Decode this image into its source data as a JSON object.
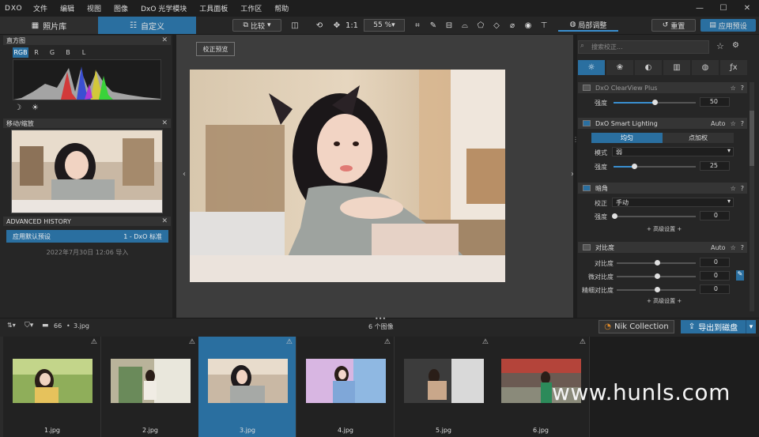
{
  "app": {
    "logo": "DXO",
    "menu": [
      "文件",
      "编辑",
      "视图",
      "图像",
      "DxO 光学模块",
      "工具面板",
      "工作区",
      "帮助"
    ]
  },
  "window": {
    "min": "—",
    "max": "☐",
    "close": "✕"
  },
  "toolbar": {
    "tab_photo": "照片库",
    "tab_custom": "自定义",
    "compare": "比较",
    "fit_label": "1:1",
    "zoom": "55 %",
    "local_adjust": "局部调整",
    "reset": "重置",
    "apply_preset": "应用预设"
  },
  "left": {
    "histogram_title": "直方图",
    "hist_tabs": [
      "RGB",
      "R",
      "G",
      "B",
      "L"
    ],
    "nav_title": "移动/缩放",
    "history_title": "ADVANCED HISTORY",
    "history_item": "应用默认预设",
    "history_preset": "1 - DxO 标准",
    "history_date": "2022年7月30日 12:06 导入"
  },
  "viewer": {
    "preview_button": "校正预览"
  },
  "right": {
    "search_placeholder": "搜索校正...",
    "clearview": {
      "title": "DxO ClearView Plus",
      "strength_label": "强度",
      "strength": "50",
      "strength_fraction": 0.5
    },
    "smart_lighting": {
      "title": "DxO Smart Lighting",
      "mode_auto": "Auto",
      "tab_uniform": "均匀",
      "tab_spot": "点加权",
      "mode_label": "模式",
      "mode_value": "弱",
      "strength_label": "强度",
      "strength": "25",
      "strength_fraction": 0.25
    },
    "vignetting": {
      "title": "暗角",
      "correction_label": "校正",
      "correction_value": "手动",
      "strength_label": "强度",
      "strength": "0",
      "advanced": "+ 高级设置 +"
    },
    "contrast": {
      "title": "对比度",
      "mode_auto": "Auto",
      "rows": [
        {
          "label": "对比度",
          "value": "0"
        },
        {
          "label": "微对比度",
          "value": "0"
        },
        {
          "label": "精细对比度",
          "value": "0"
        }
      ],
      "advanced": "+ 高级设置 +"
    }
  },
  "filmbar": {
    "count": "66",
    "filename": "3.jpg",
    "images_label": "6 个图像",
    "nik": "Nik Collection",
    "export": "导出到磁盘"
  },
  "film": [
    {
      "name": "1.jpg"
    },
    {
      "name": "2.jpg"
    },
    {
      "name": "3.jpg"
    },
    {
      "name": "4.jpg"
    },
    {
      "name": "5.jpg"
    },
    {
      "name": "6.jpg"
    }
  ],
  "watermark": "www.hunls.com",
  "colors": {
    "accent": "#2a6fa0",
    "panel": "#262626"
  }
}
